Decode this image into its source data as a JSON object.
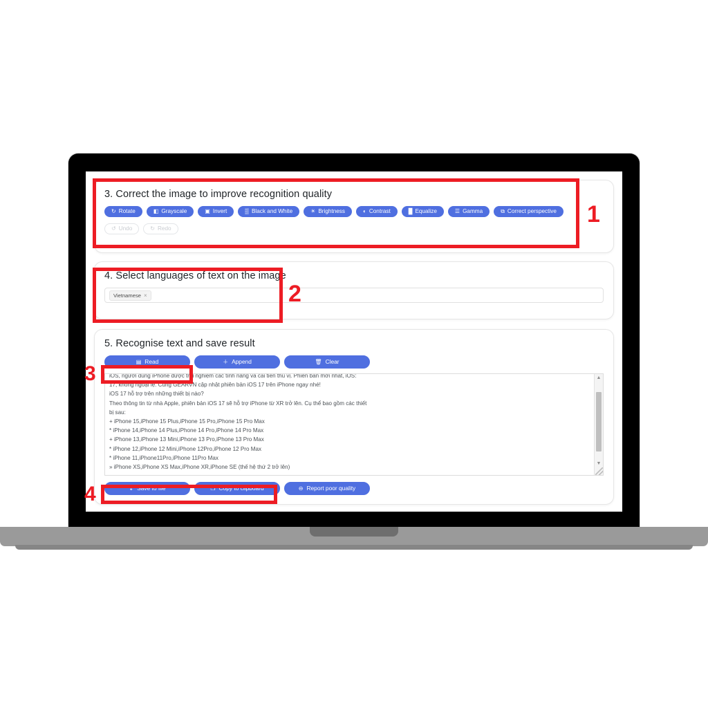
{
  "device": {
    "type": "laptop"
  },
  "sections": {
    "correct": {
      "title": "3. Correct the image to improve recognition quality",
      "buttons": [
        {
          "label": "Rotate",
          "icon": "rotate-icon",
          "glyph": "↻",
          "disabled": false
        },
        {
          "label": "Grayscale",
          "icon": "grayscale-icon",
          "glyph": "◧",
          "disabled": false
        },
        {
          "label": "Invert",
          "icon": "invert-icon",
          "glyph": "▣",
          "disabled": false
        },
        {
          "label": "Black and White",
          "icon": "black-and-white-icon",
          "glyph": "▒",
          "disabled": false
        },
        {
          "label": "Brightness",
          "icon": "brightness-icon",
          "glyph": "☀",
          "disabled": false
        },
        {
          "label": "Contrast",
          "icon": "contrast-icon",
          "glyph": "◐",
          "disabled": false
        },
        {
          "label": "Equalize",
          "icon": "equalize-icon",
          "glyph": "█",
          "disabled": false
        },
        {
          "label": "Gamma",
          "icon": "gamma-icon",
          "glyph": "☰",
          "disabled": false
        },
        {
          "label": "Correct perspective",
          "icon": "correct-perspective-icon",
          "glyph": "⧉",
          "disabled": false
        }
      ],
      "history_buttons": [
        {
          "label": "Undo",
          "icon": "undo-icon",
          "glyph": "↺",
          "disabled": true
        },
        {
          "label": "Redo",
          "icon": "redo-icon",
          "glyph": "↻",
          "disabled": true
        }
      ]
    },
    "languages": {
      "title": "4. Select languages of text on the image",
      "selected": [
        {
          "label": "Vietnamese",
          "remove": "×"
        }
      ],
      "placeholder": ""
    },
    "recognise": {
      "title": "5. Recognise text and save result",
      "action_buttons": [
        {
          "label": "Read",
          "icon": "read-icon",
          "glyph": "▤"
        },
        {
          "label": "Append",
          "icon": "append-icon",
          "glyph": "＋"
        },
        {
          "label": "Clear",
          "icon": "clear-icon",
          "glyph": "🗑"
        }
      ],
      "result_text": "iOS, người dùng iPhone được trải nghiệm các tính năng và cải tiến thú vị. Phiên bản mới nhất, iOS:\n17, không ngoại lệ. Cùng GEARVN cập nhật phiên bản iOS 17 trên iPhone ngay nhé!\niOS 17 hỗ trợ trên những thiết bị nào?\nTheo thông tin từ nhà Apple, phiên bản iOS 17 sẽ hỗ trợ iPhone từ XR trở lên. Cụ thể bao gồm các thiết\nbị sau:\n+ iPhone 15,iPhone 15 Plus,iPhone 15 Pro,iPhone 15 Pro Max\n* iPhone 14,iPhone 14 Plus,iPhone 14 Pro,iPhone 14 Pro Max\n+ iPhone 13,iPhone 13 Mini,iPhone 13 Pro,iPhone 13 Pro Max\n* iPhone 12,iPhone 12 Mini,iPhone 12Pro,iPhone 12 Pro Max\n* iPhone 11,iPhone11Pro,iPhone 11Pro Max\n» iPhone XS,iPhone XS Max,iPhone XR,iPhone SE (thế hệ thứ 2 trở lên)",
      "save_buttons": [
        {
          "label": "Save to file",
          "icon": "download-icon",
          "glyph": "↧"
        },
        {
          "label": "Copy to clipboard",
          "icon": "clipboard-icon",
          "glyph": "❐"
        },
        {
          "label": "Report poor quality",
          "icon": "report-icon",
          "glyph": "⊖"
        }
      ],
      "scroll_up": "▲",
      "scroll_down": "▼"
    }
  },
  "annotations": [
    {
      "number": "1"
    },
    {
      "number": "2"
    },
    {
      "number": "3"
    },
    {
      "number": "4"
    }
  ],
  "colors": {
    "accent": "#4f6fe0",
    "annotation": "#ed1c24",
    "card_border": "#e6e6e6",
    "text": "#212529"
  }
}
